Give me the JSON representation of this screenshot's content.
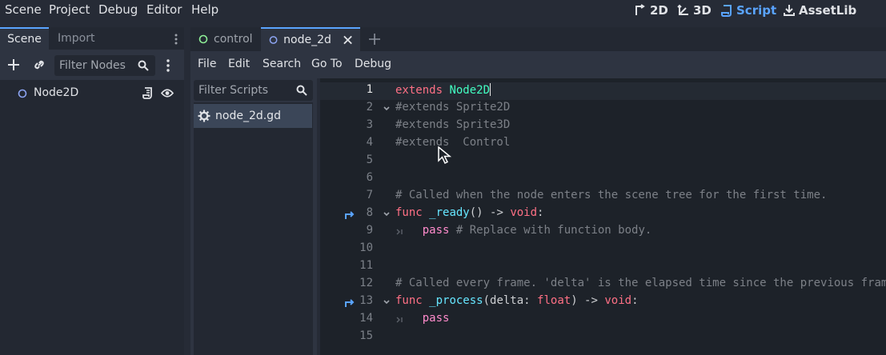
{
  "menubar": {
    "items": [
      "Scene",
      "Project",
      "Debug",
      "Editor",
      "Help"
    ],
    "workspaces": [
      {
        "label": "2D",
        "icon": "2d-icon"
      },
      {
        "label": "3D",
        "icon": "3d-icon"
      },
      {
        "label": "Script",
        "icon": "script-icon",
        "active": true
      },
      {
        "label": "AssetLib",
        "icon": "assetlib-icon"
      }
    ]
  },
  "scene_dock": {
    "tabs": [
      "Scene",
      "Import"
    ],
    "filter_placeholder": "Filter Nodes",
    "nodes": [
      {
        "name": "Node2D"
      }
    ]
  },
  "editor": {
    "tabs": [
      {
        "label": "control",
        "icon": "control-icon"
      },
      {
        "label": "node_2d",
        "icon": "node2d-icon",
        "active": true
      }
    ],
    "script_menu": [
      "File",
      "Edit",
      "Search",
      "Go To",
      "Debug"
    ],
    "filter_scripts_placeholder": "Filter Scripts",
    "scripts": [
      {
        "name": "node_2d.gd"
      }
    ],
    "current_line": 1
  },
  "code": {
    "lines": [
      {
        "n": "1",
        "tokens": [
          [
            "kw",
            "extends"
          ],
          [
            "tx",
            " "
          ],
          [
            "ty",
            "Node2D"
          ]
        ]
      },
      {
        "n": "2",
        "tokens": [
          [
            "cm",
            "#extends Sprite2D"
          ]
        ]
      },
      {
        "n": "3",
        "tokens": [
          [
            "cm",
            "#extends Sprite3D"
          ]
        ]
      },
      {
        "n": "4",
        "tokens": [
          [
            "cm",
            "#extends  Control"
          ]
        ]
      },
      {
        "n": "5",
        "tokens": []
      },
      {
        "n": "6",
        "tokens": []
      },
      {
        "n": "7",
        "tokens": [
          [
            "cm",
            "# Called when the node enters the scene tree for the first time."
          ]
        ]
      },
      {
        "n": "8",
        "tokens": [
          [
            "kw",
            "func"
          ],
          [
            "tx",
            " "
          ],
          [
            "fn",
            "_ready"
          ],
          [
            "tx",
            "() -> "
          ],
          [
            "kw",
            "void"
          ],
          [
            "tx",
            ":"
          ]
        ]
      },
      {
        "n": "9",
        "tokens": [
          [
            "tx",
            "    "
          ],
          [
            "bp",
            "pass"
          ],
          [
            "tx",
            " "
          ],
          [
            "cm",
            "# Replace with function body."
          ]
        ]
      },
      {
        "n": "10",
        "tokens": []
      },
      {
        "n": "11",
        "tokens": []
      },
      {
        "n": "12",
        "tokens": [
          [
            "cm",
            "# Called every frame. 'delta' is the elapsed time since the previous fram"
          ]
        ]
      },
      {
        "n": "13",
        "tokens": [
          [
            "kw",
            "func"
          ],
          [
            "tx",
            " "
          ],
          [
            "fn",
            "_process"
          ],
          [
            "tx",
            "(delta: "
          ],
          [
            "kw",
            "float"
          ],
          [
            "tx",
            ") -> "
          ],
          [
            "kw",
            "void"
          ],
          [
            "tx",
            ":"
          ]
        ]
      },
      {
        "n": "14",
        "tokens": [
          [
            "tx",
            "    "
          ],
          [
            "bp",
            "pass"
          ]
        ]
      },
      {
        "n": "15",
        "tokens": []
      }
    ]
  },
  "colors": {
    "accent": "#5aa4ff",
    "keyword": "#ff7085",
    "type": "#42ffc2",
    "comment": "#7c8087",
    "function": "#66e6ff"
  }
}
